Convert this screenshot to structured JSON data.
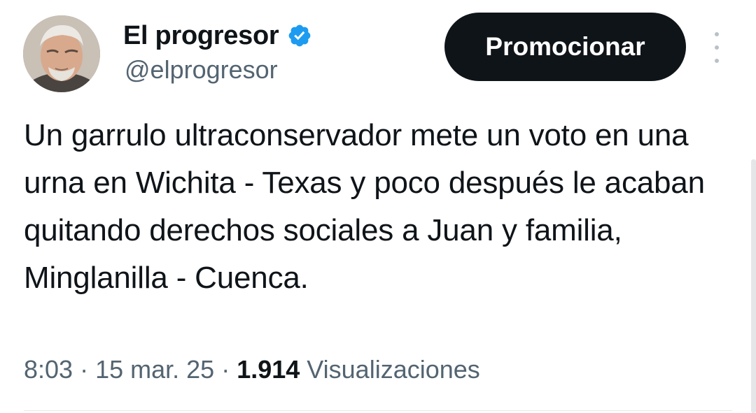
{
  "author": {
    "display_name": "El progresor",
    "handle": "@elprogresor",
    "verified": true,
    "verified_color": "#1d9bf0"
  },
  "actions": {
    "promote_label": "Promocionar",
    "more_icon": "more-vertical-icon"
  },
  "tweet": {
    "text": "Un garrulo ultraconservador mete un voto en una urna en Wichita - Texas y poco después le acaban quitando derechos sociales a Juan y familia, Minglanilla - Cuenca."
  },
  "meta": {
    "time": "8:03",
    "separator": " · ",
    "date": "15 mar. 25",
    "views_count": "1.914",
    "views_label": "Visualizaciones"
  }
}
